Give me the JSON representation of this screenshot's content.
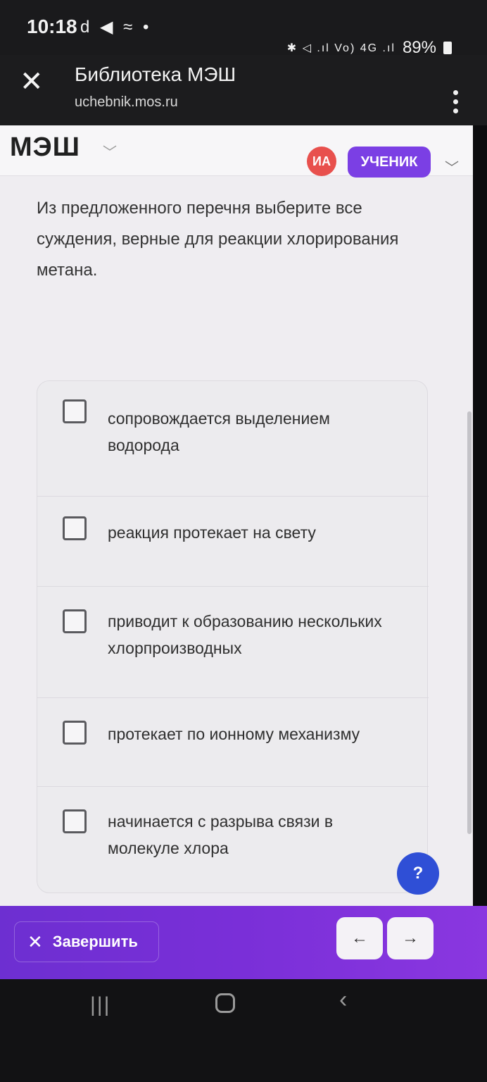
{
  "status_bar": {
    "time": "10:18",
    "left_icons": "d ◀ ≈ •",
    "right_icons": "✱ ◁ .ıl Vo) 4G .ıl",
    "battery": "89%"
  },
  "browser": {
    "title": "Библиотека МЭШ",
    "url": "uchebnik.mos.ru"
  },
  "app_header": {
    "logo": "МЭШ",
    "avatar_initials": "ИА",
    "role": "УЧЕНИК"
  },
  "question": {
    "text": "Из предложенного перечня выберите все суждения, верные для реакции хлорирования метана."
  },
  "options": [
    {
      "label": "сопровождается выделением водорода",
      "checked": false
    },
    {
      "label": "реакция протекает на свету",
      "checked": false
    },
    {
      "label": "приводит к образованию нескольких хлорпроизводных",
      "checked": false
    },
    {
      "label": "протекает по ионному механизму",
      "checked": false
    },
    {
      "label": "начинается с разрыва связи в молекуле хлора",
      "checked": false
    }
  ],
  "help": {
    "label": "?"
  },
  "bottom_bar": {
    "finish_label": "Завершить",
    "prev_label": "←",
    "next_label": "→"
  },
  "colors": {
    "accent": "#7b3fe4",
    "avatar": "#e8504d",
    "help": "#2f4fd6"
  }
}
